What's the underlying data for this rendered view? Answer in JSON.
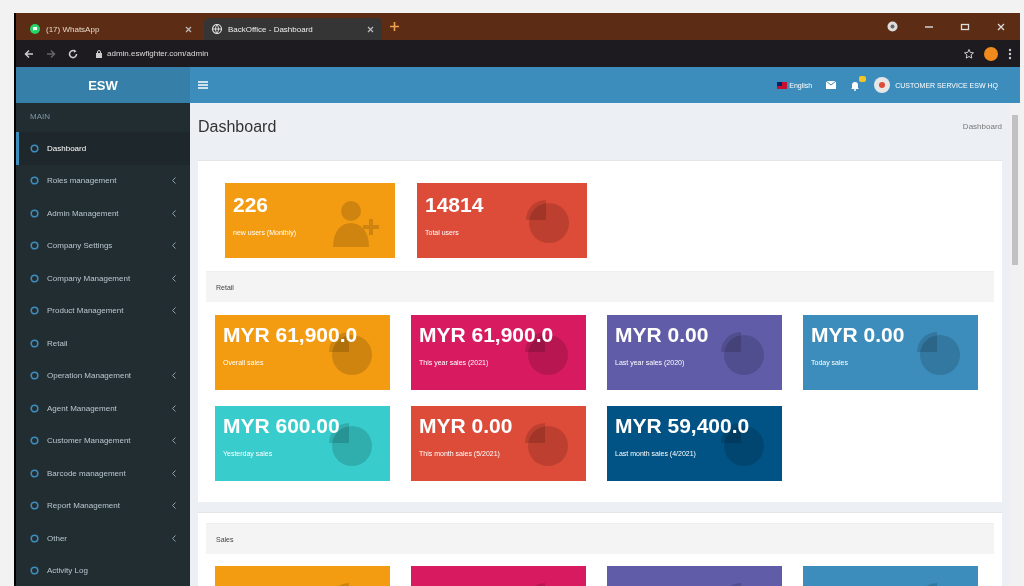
{
  "browser": {
    "tabs": [
      {
        "title": "(17) WhatsApp",
        "selected": false
      },
      {
        "title": "BackOffice - Dashboard",
        "selected": true
      }
    ],
    "url": "admin.eswfighter.com/admin"
  },
  "header": {
    "logo": "ESW",
    "language": "English",
    "user": "CUSTOMER SERVICE ESW HQ"
  },
  "sidebar": {
    "label": "MAIN",
    "items": [
      {
        "label": "Dashboard",
        "selected": true,
        "has_submenu": false
      },
      {
        "label": "Roles management",
        "selected": false,
        "has_submenu": true
      },
      {
        "label": "Admin Management",
        "selected": false,
        "has_submenu": true
      },
      {
        "label": "Company Settings",
        "selected": false,
        "has_submenu": true
      },
      {
        "label": "Company Management",
        "selected": false,
        "has_submenu": true
      },
      {
        "label": "Product Management",
        "selected": false,
        "has_submenu": true
      },
      {
        "label": "Retail",
        "selected": false,
        "has_submenu": false
      },
      {
        "label": "Operation Management",
        "selected": false,
        "has_submenu": true
      },
      {
        "label": "Agent Management",
        "selected": false,
        "has_submenu": true
      },
      {
        "label": "Customer Management",
        "selected": false,
        "has_submenu": true
      },
      {
        "label": "Barcode management",
        "selected": false,
        "has_submenu": true
      },
      {
        "label": "Report Management",
        "selected": false,
        "has_submenu": true
      },
      {
        "label": "Other",
        "selected": false,
        "has_submenu": true
      },
      {
        "label": "Activity Log",
        "selected": false,
        "has_submenu": false
      }
    ]
  },
  "page": {
    "title": "Dashboard",
    "breadcrumb": "Dashboard"
  },
  "stats": [
    {
      "value": "226",
      "label": "new users (Monthly)",
      "color": "#f39c12"
    },
    {
      "value": "14814",
      "label": "Total users",
      "color": "#dd4b39"
    }
  ],
  "sections": [
    {
      "title": "Retail",
      "cards": [
        {
          "value": "MYR 61,900.0",
          "label": "Overall sales",
          "color": "#f39c12"
        },
        {
          "value": "MYR 61,900.0",
          "label": "This year sales (2021)",
          "color": "#d81b60"
        },
        {
          "value": "MYR 0.00",
          "label": "Last year sales (2020)",
          "color": "#605ca8"
        },
        {
          "value": "MYR 0.00",
          "label": "Today sales",
          "color": "#3c8dbc"
        },
        {
          "value": "MYR 600.00",
          "label": "Yesterday sales",
          "color": "#39cccc"
        },
        {
          "value": "MYR 0.00",
          "label": "This month sales (5/2021)",
          "color": "#dd4b39"
        },
        {
          "value": "MYR 59,400.0",
          "label": "Last month sales (4/2021)",
          "color": "#005384"
        }
      ]
    },
    {
      "title": "Sales",
      "cards": [
        {
          "color": "#f39c12"
        },
        {
          "color": "#d81b60"
        },
        {
          "color": "#605ca8"
        },
        {
          "color": "#3c8dbc"
        }
      ]
    }
  ]
}
